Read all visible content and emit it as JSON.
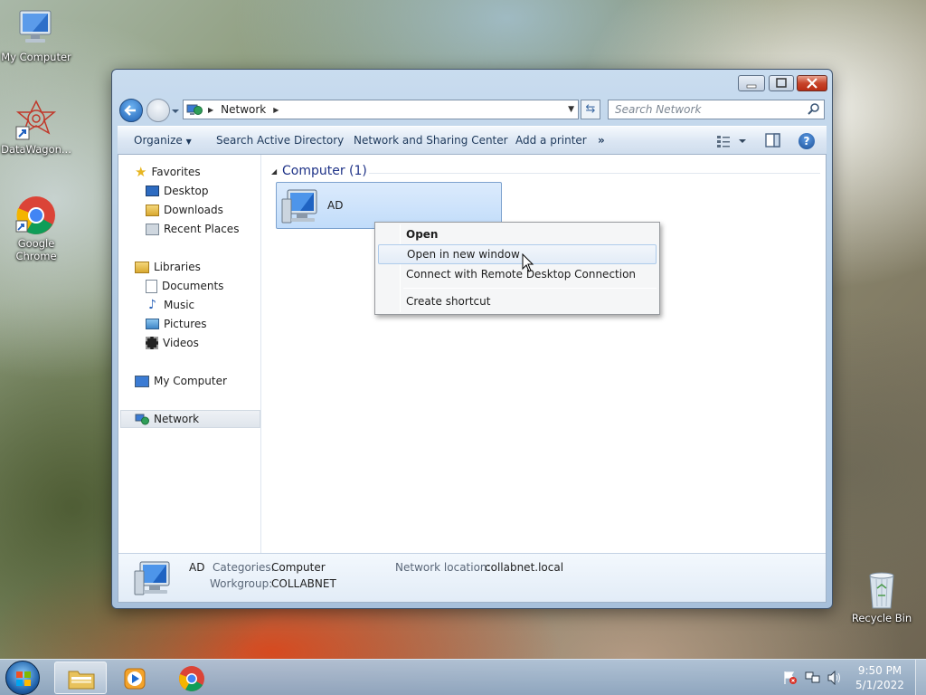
{
  "desktop": {
    "icons": [
      {
        "label": "My Computer",
        "icon": "computer-icon"
      },
      {
        "label": "DataWagon...",
        "icon": "datawagon-shortcut-icon"
      },
      {
        "label": "Google Chrome",
        "icon": "chrome-icon"
      },
      {
        "label": "Recycle Bin",
        "icon": "recycle-bin-icon"
      }
    ]
  },
  "window": {
    "address": {
      "crumb": "Network"
    },
    "search": {
      "placeholder": "Search Network"
    },
    "toolbar": {
      "organize": "Organize",
      "search_ad": "Search Active Directory",
      "network_sharing": "Network and Sharing Center",
      "add_printer": "Add a printer",
      "more": "»"
    },
    "nav": {
      "favorites": "Favorites",
      "desktop": "Desktop",
      "downloads": "Downloads",
      "recent": "Recent Places",
      "libraries": "Libraries",
      "documents": "Documents",
      "music": "Music",
      "pictures": "Pictures",
      "videos": "Videos",
      "my_computer": "My Computer",
      "network": "Network"
    },
    "group": {
      "title": "Computer (1)"
    },
    "item": {
      "name": "AD"
    },
    "details": {
      "name": "AD",
      "categories_label": "Categories:",
      "categories_value": "Computer",
      "workgroup_label": "Workgroup:",
      "workgroup_value": "COLLABNET",
      "location_label": "Network location:",
      "location_value": "collabnet.local"
    }
  },
  "context_menu": {
    "items": [
      "Open",
      "Open in new window",
      "Connect with Remote Desktop Connection",
      "Create shortcut"
    ]
  },
  "taskbar": {
    "time": "9:50 PM",
    "date": "5/1/2022"
  },
  "colors": {
    "accent": "#3399ff",
    "group_title": "#1e3287",
    "selection": "#cce8ff"
  }
}
